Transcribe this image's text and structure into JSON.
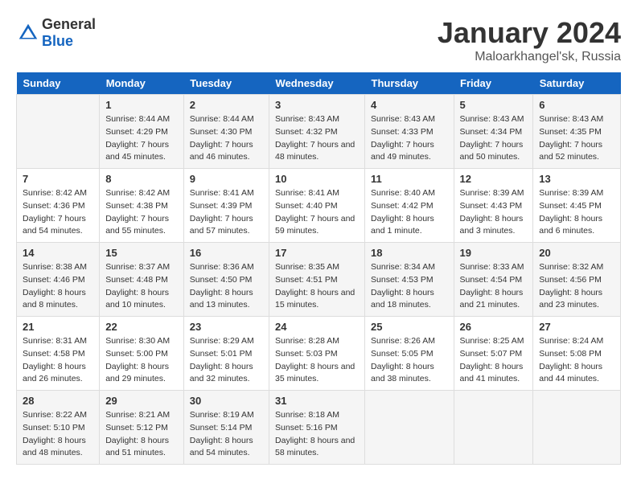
{
  "header": {
    "logo_general": "General",
    "logo_blue": "Blue",
    "month": "January 2024",
    "location": "Maloarkhangel'sk, Russia"
  },
  "days_of_week": [
    "Sunday",
    "Monday",
    "Tuesday",
    "Wednesday",
    "Thursday",
    "Friday",
    "Saturday"
  ],
  "weeks": [
    [
      {
        "day": "",
        "sunrise": "",
        "sunset": "",
        "daylight": ""
      },
      {
        "day": "1",
        "sunrise": "Sunrise: 8:44 AM",
        "sunset": "Sunset: 4:29 PM",
        "daylight": "Daylight: 7 hours and 45 minutes."
      },
      {
        "day": "2",
        "sunrise": "Sunrise: 8:44 AM",
        "sunset": "Sunset: 4:30 PM",
        "daylight": "Daylight: 7 hours and 46 minutes."
      },
      {
        "day": "3",
        "sunrise": "Sunrise: 8:43 AM",
        "sunset": "Sunset: 4:32 PM",
        "daylight": "Daylight: 7 hours and 48 minutes."
      },
      {
        "day": "4",
        "sunrise": "Sunrise: 8:43 AM",
        "sunset": "Sunset: 4:33 PM",
        "daylight": "Daylight: 7 hours and 49 minutes."
      },
      {
        "day": "5",
        "sunrise": "Sunrise: 8:43 AM",
        "sunset": "Sunset: 4:34 PM",
        "daylight": "Daylight: 7 hours and 50 minutes."
      },
      {
        "day": "6",
        "sunrise": "Sunrise: 8:43 AM",
        "sunset": "Sunset: 4:35 PM",
        "daylight": "Daylight: 7 hours and 52 minutes."
      }
    ],
    [
      {
        "day": "7",
        "sunrise": "Sunrise: 8:42 AM",
        "sunset": "Sunset: 4:36 PM",
        "daylight": "Daylight: 7 hours and 54 minutes."
      },
      {
        "day": "8",
        "sunrise": "Sunrise: 8:42 AM",
        "sunset": "Sunset: 4:38 PM",
        "daylight": "Daylight: 7 hours and 55 minutes."
      },
      {
        "day": "9",
        "sunrise": "Sunrise: 8:41 AM",
        "sunset": "Sunset: 4:39 PM",
        "daylight": "Daylight: 7 hours and 57 minutes."
      },
      {
        "day": "10",
        "sunrise": "Sunrise: 8:41 AM",
        "sunset": "Sunset: 4:40 PM",
        "daylight": "Daylight: 7 hours and 59 minutes."
      },
      {
        "day": "11",
        "sunrise": "Sunrise: 8:40 AM",
        "sunset": "Sunset: 4:42 PM",
        "daylight": "Daylight: 8 hours and 1 minute."
      },
      {
        "day": "12",
        "sunrise": "Sunrise: 8:39 AM",
        "sunset": "Sunset: 4:43 PM",
        "daylight": "Daylight: 8 hours and 3 minutes."
      },
      {
        "day": "13",
        "sunrise": "Sunrise: 8:39 AM",
        "sunset": "Sunset: 4:45 PM",
        "daylight": "Daylight: 8 hours and 6 minutes."
      }
    ],
    [
      {
        "day": "14",
        "sunrise": "Sunrise: 8:38 AM",
        "sunset": "Sunset: 4:46 PM",
        "daylight": "Daylight: 8 hours and 8 minutes."
      },
      {
        "day": "15",
        "sunrise": "Sunrise: 8:37 AM",
        "sunset": "Sunset: 4:48 PM",
        "daylight": "Daylight: 8 hours and 10 minutes."
      },
      {
        "day": "16",
        "sunrise": "Sunrise: 8:36 AM",
        "sunset": "Sunset: 4:50 PM",
        "daylight": "Daylight: 8 hours and 13 minutes."
      },
      {
        "day": "17",
        "sunrise": "Sunrise: 8:35 AM",
        "sunset": "Sunset: 4:51 PM",
        "daylight": "Daylight: 8 hours and 15 minutes."
      },
      {
        "day": "18",
        "sunrise": "Sunrise: 8:34 AM",
        "sunset": "Sunset: 4:53 PM",
        "daylight": "Daylight: 8 hours and 18 minutes."
      },
      {
        "day": "19",
        "sunrise": "Sunrise: 8:33 AM",
        "sunset": "Sunset: 4:54 PM",
        "daylight": "Daylight: 8 hours and 21 minutes."
      },
      {
        "day": "20",
        "sunrise": "Sunrise: 8:32 AM",
        "sunset": "Sunset: 4:56 PM",
        "daylight": "Daylight: 8 hours and 23 minutes."
      }
    ],
    [
      {
        "day": "21",
        "sunrise": "Sunrise: 8:31 AM",
        "sunset": "Sunset: 4:58 PM",
        "daylight": "Daylight: 8 hours and 26 minutes."
      },
      {
        "day": "22",
        "sunrise": "Sunrise: 8:30 AM",
        "sunset": "Sunset: 5:00 PM",
        "daylight": "Daylight: 8 hours and 29 minutes."
      },
      {
        "day": "23",
        "sunrise": "Sunrise: 8:29 AM",
        "sunset": "Sunset: 5:01 PM",
        "daylight": "Daylight: 8 hours and 32 minutes."
      },
      {
        "day": "24",
        "sunrise": "Sunrise: 8:28 AM",
        "sunset": "Sunset: 5:03 PM",
        "daylight": "Daylight: 8 hours and 35 minutes."
      },
      {
        "day": "25",
        "sunrise": "Sunrise: 8:26 AM",
        "sunset": "Sunset: 5:05 PM",
        "daylight": "Daylight: 8 hours and 38 minutes."
      },
      {
        "day": "26",
        "sunrise": "Sunrise: 8:25 AM",
        "sunset": "Sunset: 5:07 PM",
        "daylight": "Daylight: 8 hours and 41 minutes."
      },
      {
        "day": "27",
        "sunrise": "Sunrise: 8:24 AM",
        "sunset": "Sunset: 5:08 PM",
        "daylight": "Daylight: 8 hours and 44 minutes."
      }
    ],
    [
      {
        "day": "28",
        "sunrise": "Sunrise: 8:22 AM",
        "sunset": "Sunset: 5:10 PM",
        "daylight": "Daylight: 8 hours and 48 minutes."
      },
      {
        "day": "29",
        "sunrise": "Sunrise: 8:21 AM",
        "sunset": "Sunset: 5:12 PM",
        "daylight": "Daylight: 8 hours and 51 minutes."
      },
      {
        "day": "30",
        "sunrise": "Sunrise: 8:19 AM",
        "sunset": "Sunset: 5:14 PM",
        "daylight": "Daylight: 8 hours and 54 minutes."
      },
      {
        "day": "31",
        "sunrise": "Sunrise: 8:18 AM",
        "sunset": "Sunset: 5:16 PM",
        "daylight": "Daylight: 8 hours and 58 minutes."
      },
      {
        "day": "",
        "sunrise": "",
        "sunset": "",
        "daylight": ""
      },
      {
        "day": "",
        "sunrise": "",
        "sunset": "",
        "daylight": ""
      },
      {
        "day": "",
        "sunrise": "",
        "sunset": "",
        "daylight": ""
      }
    ]
  ]
}
